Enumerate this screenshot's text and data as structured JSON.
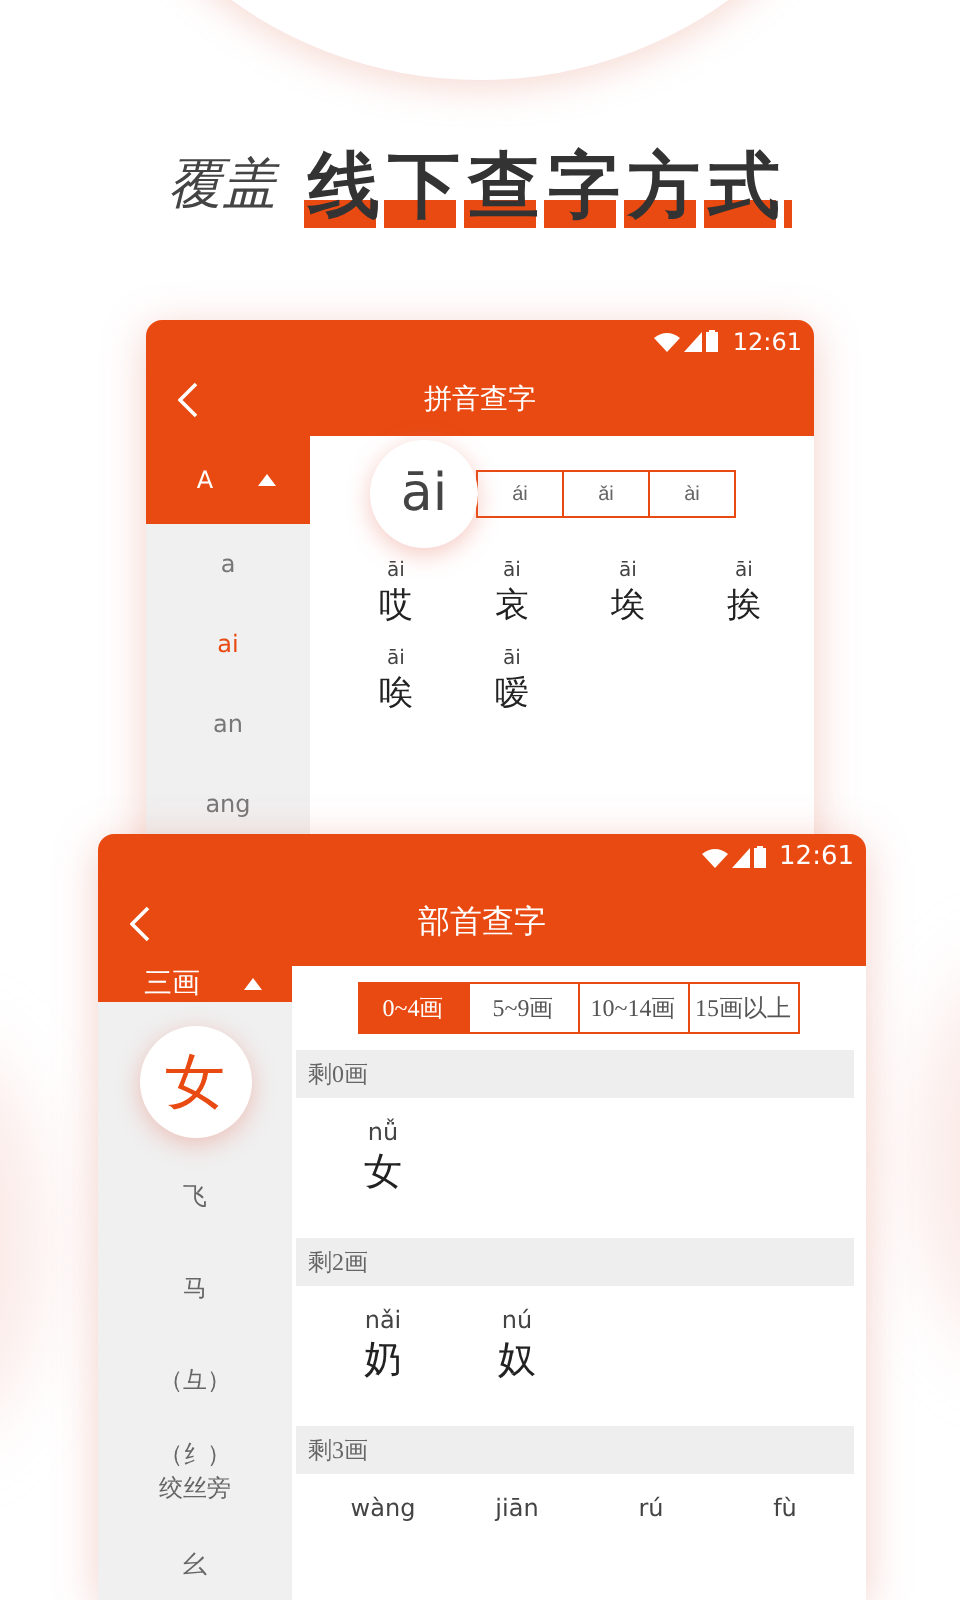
{
  "headline": {
    "lead": "覆盖",
    "highlight": "线下查字方式"
  },
  "screens": [
    {
      "kind": "pinyin",
      "status_time": "12:61",
      "title": "拼音查字",
      "sidebar": {
        "header": "A",
        "items": [
          {
            "label": "a",
            "selected": false
          },
          {
            "label": "ai",
            "selected": true
          },
          {
            "label": "an",
            "selected": false
          },
          {
            "label": "ang",
            "selected": false
          }
        ]
      },
      "tabs": [
        {
          "label": "āi",
          "selected": true
        },
        {
          "label": "ái",
          "selected": false
        },
        {
          "label": "ǎi",
          "selected": false
        },
        {
          "label": "ài",
          "selected": false
        }
      ],
      "chars": [
        {
          "pinyin": "āi",
          "char": "哎"
        },
        {
          "pinyin": "āi",
          "char": "哀"
        },
        {
          "pinyin": "āi",
          "char": "埃"
        },
        {
          "pinyin": "āi",
          "char": "挨"
        },
        {
          "pinyin": "āi",
          "char": "唉"
        },
        {
          "pinyin": "āi",
          "char": "嗳"
        }
      ]
    },
    {
      "kind": "radical",
      "status_time": "12:61",
      "title": "部首查字",
      "sidebar": {
        "header": "三画",
        "items": [
          {
            "label": "女",
            "selected": true
          },
          {
            "label": "飞",
            "selected": false
          },
          {
            "label": "马",
            "selected": false
          },
          {
            "label": "（彑）",
            "selected": false
          },
          {
            "label": "（纟）",
            "sub": "绞丝旁",
            "selected": false
          },
          {
            "label": "幺",
            "selected": false
          }
        ]
      },
      "tabs": [
        {
          "label": "0~4画",
          "selected": true
        },
        {
          "label": "5~9画",
          "selected": false
        },
        {
          "label": "10~14画",
          "selected": false
        },
        {
          "label": "15画以上",
          "selected": false
        }
      ],
      "sections": [
        {
          "header": "剩0画",
          "chars": [
            {
              "pinyin": "nǚ",
              "char": "女"
            }
          ]
        },
        {
          "header": "剩2画",
          "chars": [
            {
              "pinyin": "nǎi",
              "char": "奶"
            },
            {
              "pinyin": "nú",
              "char": "奴"
            }
          ]
        },
        {
          "header": "剩3画",
          "chars": [
            {
              "pinyin": "wàng"
            },
            {
              "pinyin": "jiān"
            },
            {
              "pinyin": "rú"
            },
            {
              "pinyin": "fù"
            }
          ]
        }
      ]
    }
  ]
}
